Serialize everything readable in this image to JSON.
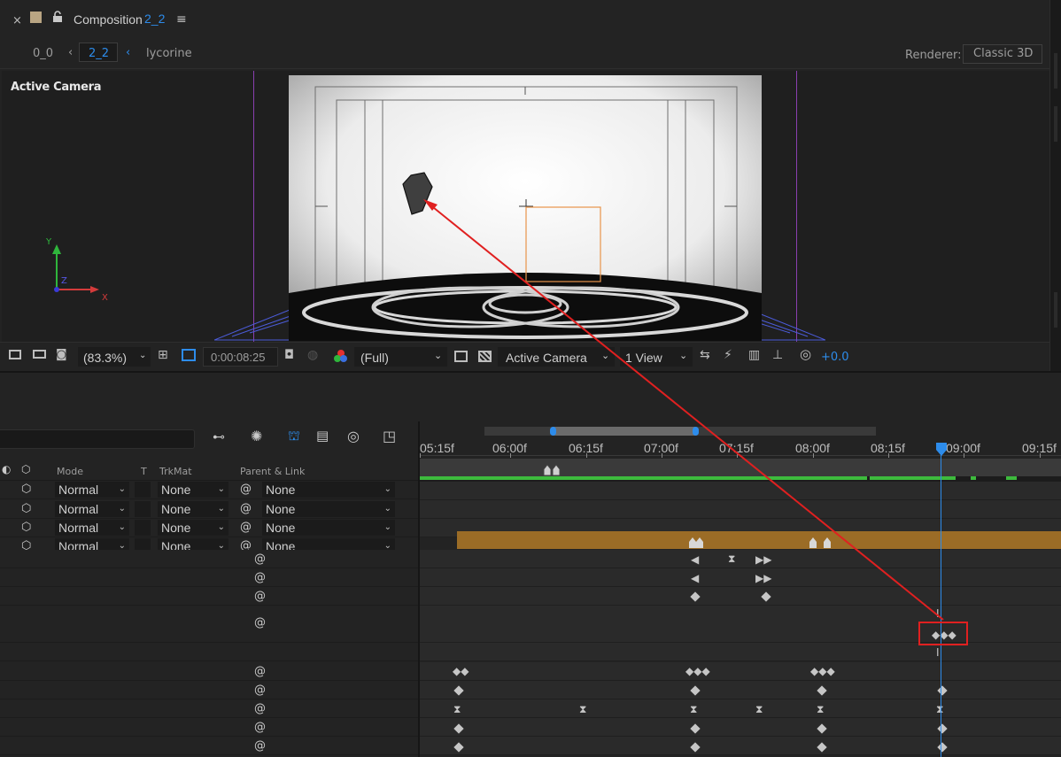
{
  "composition_panel": {
    "tab_title": "Composition",
    "tab_comp_name": "2_2",
    "breadcrumbs": [
      "0_0",
      "2_2",
      "lycorine"
    ],
    "renderer_label": "Renderer:",
    "renderer_value": "Classic 3D",
    "viewer_label": "Active Camera",
    "axis_labels": {
      "y": "Y",
      "z": "Z",
      "x": "X"
    }
  },
  "viewer_toolbar": {
    "zoom": "(83.3%)",
    "timecode": "0:00:08:25",
    "resolution": "(Full)",
    "camera": "Active Camera",
    "view_layout": "1 View",
    "exposure": "+0.0"
  },
  "timeline": {
    "column_headers": {
      "mode": "Mode",
      "t": "T",
      "trkmat": "TrkMat",
      "parent": "Parent & Link"
    },
    "ruler_ticks": [
      "05:15f",
      "06:00f",
      "06:15f",
      "07:00f",
      "07:15f",
      "08:00f",
      "08:15f",
      "09:00f",
      "09:15f"
    ],
    "layers": [
      {
        "mode": "Normal",
        "trkmat": "None",
        "parent": "None"
      },
      {
        "mode": "Normal",
        "trkmat": "None",
        "parent": "None"
      },
      {
        "mode": "Normal",
        "trkmat": "None",
        "parent": "None"
      },
      {
        "mode": "Normal",
        "trkmat": "None",
        "parent": "None"
      }
    ]
  },
  "colors": {
    "accent_blue": "#2d8ceb",
    "annotation_red": "#e02020",
    "layer_bar_orange": "#9b6c26",
    "work_area_green": "#3dbb3d",
    "selection_orange": "#e8944a"
  }
}
